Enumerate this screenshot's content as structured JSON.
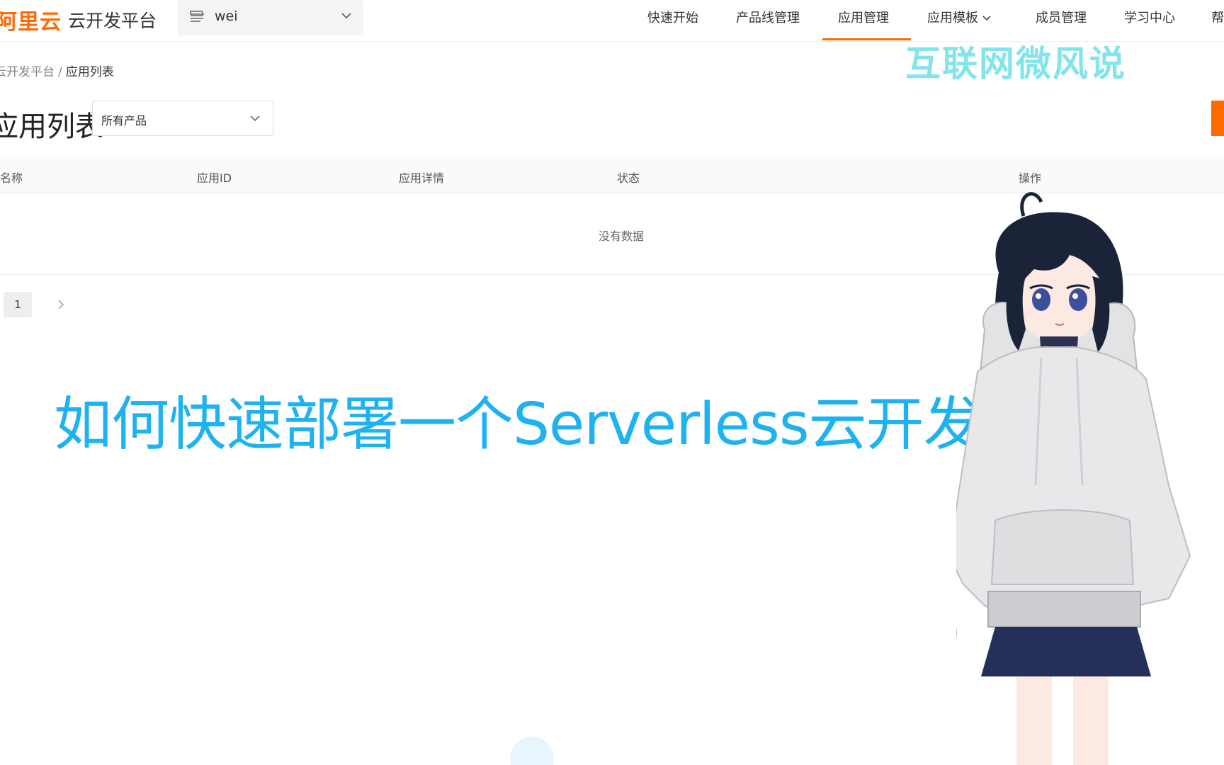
{
  "header": {
    "logo_text": "阿里云",
    "platform_title": "云开发平台",
    "workspace": {
      "name": "wei"
    },
    "nav": {
      "quick_start": "快速开始",
      "product_line": "产品线管理",
      "app_management": "应用管理",
      "app_templates": "应用模板",
      "members": "成员管理",
      "learning": "学习中心",
      "help": "帮助"
    }
  },
  "breadcrumb": {
    "root": "云开发平台",
    "separator": "/",
    "current": "应用列表"
  },
  "page": {
    "title": "应用列表",
    "product_filter": {
      "selected": "所有产品"
    }
  },
  "table": {
    "columns": {
      "name": "名称",
      "app_id": "应用ID",
      "details": "应用详情",
      "status": "状态",
      "actions": "操作"
    },
    "empty_text": "没有数据"
  },
  "pagination": {
    "current_page": "1"
  },
  "overlay": {
    "watermark": "互联网微风说",
    "video_title": "如何快速部署一个Serverless云开发项目"
  },
  "colors": {
    "accent": "#ff6a00",
    "title_overlay": "#1eb3f0",
    "watermark": "#6fe0e8"
  }
}
